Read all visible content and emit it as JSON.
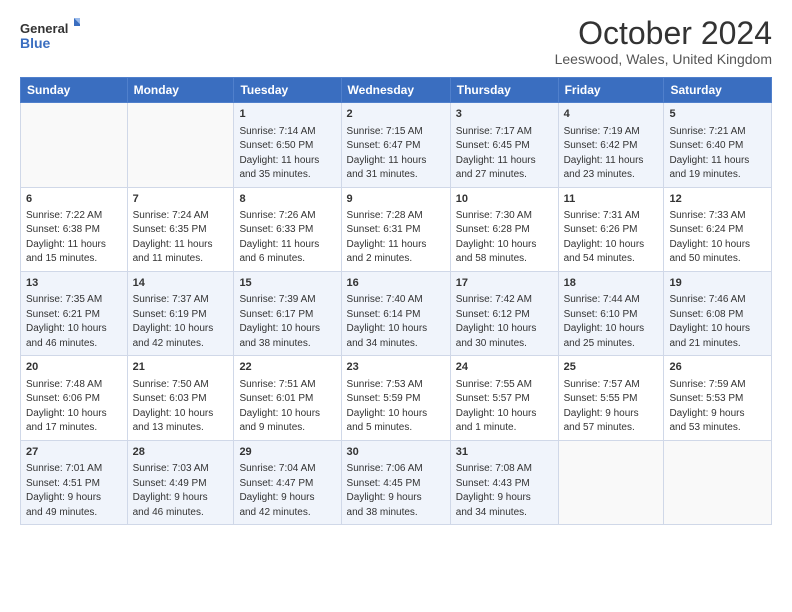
{
  "header": {
    "logo": {
      "line1": "General",
      "line2": "Blue"
    },
    "title": "October 2024",
    "subtitle": "Leeswood, Wales, United Kingdom"
  },
  "weekdays": [
    "Sunday",
    "Monday",
    "Tuesday",
    "Wednesday",
    "Thursday",
    "Friday",
    "Saturday"
  ],
  "weeks": [
    [
      {
        "day": "",
        "info": ""
      },
      {
        "day": "",
        "info": ""
      },
      {
        "day": "1",
        "info": "Sunrise: 7:14 AM\nSunset: 6:50 PM\nDaylight: 11 hours\nand 35 minutes."
      },
      {
        "day": "2",
        "info": "Sunrise: 7:15 AM\nSunset: 6:47 PM\nDaylight: 11 hours\nand 31 minutes."
      },
      {
        "day": "3",
        "info": "Sunrise: 7:17 AM\nSunset: 6:45 PM\nDaylight: 11 hours\nand 27 minutes."
      },
      {
        "day": "4",
        "info": "Sunrise: 7:19 AM\nSunset: 6:42 PM\nDaylight: 11 hours\nand 23 minutes."
      },
      {
        "day": "5",
        "info": "Sunrise: 7:21 AM\nSunset: 6:40 PM\nDaylight: 11 hours\nand 19 minutes."
      }
    ],
    [
      {
        "day": "6",
        "info": "Sunrise: 7:22 AM\nSunset: 6:38 PM\nDaylight: 11 hours\nand 15 minutes."
      },
      {
        "day": "7",
        "info": "Sunrise: 7:24 AM\nSunset: 6:35 PM\nDaylight: 11 hours\nand 11 minutes."
      },
      {
        "day": "8",
        "info": "Sunrise: 7:26 AM\nSunset: 6:33 PM\nDaylight: 11 hours\nand 6 minutes."
      },
      {
        "day": "9",
        "info": "Sunrise: 7:28 AM\nSunset: 6:31 PM\nDaylight: 11 hours\nand 2 minutes."
      },
      {
        "day": "10",
        "info": "Sunrise: 7:30 AM\nSunset: 6:28 PM\nDaylight: 10 hours\nand 58 minutes."
      },
      {
        "day": "11",
        "info": "Sunrise: 7:31 AM\nSunset: 6:26 PM\nDaylight: 10 hours\nand 54 minutes."
      },
      {
        "day": "12",
        "info": "Sunrise: 7:33 AM\nSunset: 6:24 PM\nDaylight: 10 hours\nand 50 minutes."
      }
    ],
    [
      {
        "day": "13",
        "info": "Sunrise: 7:35 AM\nSunset: 6:21 PM\nDaylight: 10 hours\nand 46 minutes."
      },
      {
        "day": "14",
        "info": "Sunrise: 7:37 AM\nSunset: 6:19 PM\nDaylight: 10 hours\nand 42 minutes."
      },
      {
        "day": "15",
        "info": "Sunrise: 7:39 AM\nSunset: 6:17 PM\nDaylight: 10 hours\nand 38 minutes."
      },
      {
        "day": "16",
        "info": "Sunrise: 7:40 AM\nSunset: 6:14 PM\nDaylight: 10 hours\nand 34 minutes."
      },
      {
        "day": "17",
        "info": "Sunrise: 7:42 AM\nSunset: 6:12 PM\nDaylight: 10 hours\nand 30 minutes."
      },
      {
        "day": "18",
        "info": "Sunrise: 7:44 AM\nSunset: 6:10 PM\nDaylight: 10 hours\nand 25 minutes."
      },
      {
        "day": "19",
        "info": "Sunrise: 7:46 AM\nSunset: 6:08 PM\nDaylight: 10 hours\nand 21 minutes."
      }
    ],
    [
      {
        "day": "20",
        "info": "Sunrise: 7:48 AM\nSunset: 6:06 PM\nDaylight: 10 hours\nand 17 minutes."
      },
      {
        "day": "21",
        "info": "Sunrise: 7:50 AM\nSunset: 6:03 PM\nDaylight: 10 hours\nand 13 minutes."
      },
      {
        "day": "22",
        "info": "Sunrise: 7:51 AM\nSunset: 6:01 PM\nDaylight: 10 hours\nand 9 minutes."
      },
      {
        "day": "23",
        "info": "Sunrise: 7:53 AM\nSunset: 5:59 PM\nDaylight: 10 hours\nand 5 minutes."
      },
      {
        "day": "24",
        "info": "Sunrise: 7:55 AM\nSunset: 5:57 PM\nDaylight: 10 hours\nand 1 minute."
      },
      {
        "day": "25",
        "info": "Sunrise: 7:57 AM\nSunset: 5:55 PM\nDaylight: 9 hours\nand 57 minutes."
      },
      {
        "day": "26",
        "info": "Sunrise: 7:59 AM\nSunset: 5:53 PM\nDaylight: 9 hours\nand 53 minutes."
      }
    ],
    [
      {
        "day": "27",
        "info": "Sunrise: 7:01 AM\nSunset: 4:51 PM\nDaylight: 9 hours\nand 49 minutes."
      },
      {
        "day": "28",
        "info": "Sunrise: 7:03 AM\nSunset: 4:49 PM\nDaylight: 9 hours\nand 46 minutes."
      },
      {
        "day": "29",
        "info": "Sunrise: 7:04 AM\nSunset: 4:47 PM\nDaylight: 9 hours\nand 42 minutes."
      },
      {
        "day": "30",
        "info": "Sunrise: 7:06 AM\nSunset: 4:45 PM\nDaylight: 9 hours\nand 38 minutes."
      },
      {
        "day": "31",
        "info": "Sunrise: 7:08 AM\nSunset: 4:43 PM\nDaylight: 9 hours\nand 34 minutes."
      },
      {
        "day": "",
        "info": ""
      },
      {
        "day": "",
        "info": ""
      }
    ]
  ]
}
